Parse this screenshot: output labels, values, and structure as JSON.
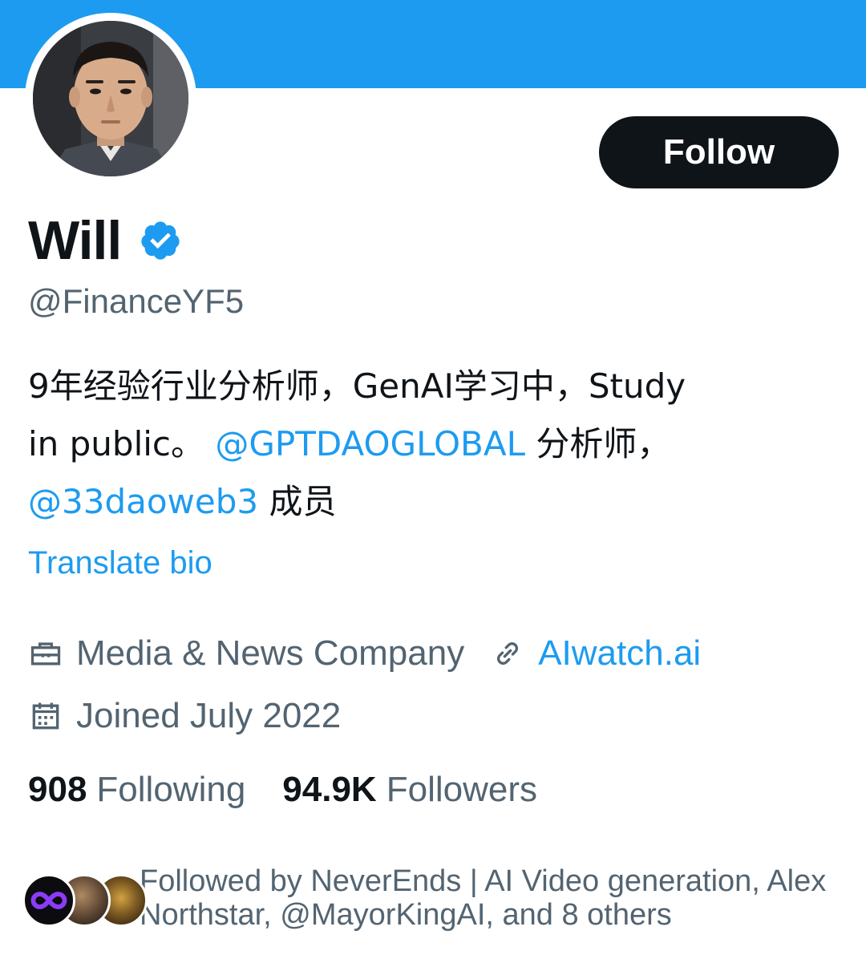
{
  "profile": {
    "name": "Will",
    "handle": "@FinanceYF5",
    "follow_label": "Follow",
    "bio": {
      "line1": "9年经验行业分析师，GenAI学习中，Study",
      "line2_prefix": "in public。 ",
      "mention1": "@GPTDAOGLOBAL",
      "line2_suffix": " 分析师，",
      "mention2": "@33daoweb3",
      "line3_suffix": " 成员"
    },
    "translate_label": "Translate bio",
    "category": "Media & News Company",
    "website": "AIwatch.ai",
    "joined": "Joined July 2022",
    "following_count": "908",
    "following_label": "Following",
    "followers_count": "94.9K",
    "followers_label": "Followers",
    "followed_by_text": "Followed by NeverEnds | AI Video generation, Alex Northstar, @MayorKingAI, and 8 others"
  },
  "colors": {
    "banner": "#1d9bf0",
    "accent": "#1d9bf0",
    "text_primary": "#0f1419",
    "text_secondary": "#536471",
    "button_bg": "#0f1419"
  },
  "icons": {
    "verified": "verified-badge-icon",
    "category": "briefcase-icon",
    "website": "link-icon",
    "joined": "calendar-icon"
  }
}
